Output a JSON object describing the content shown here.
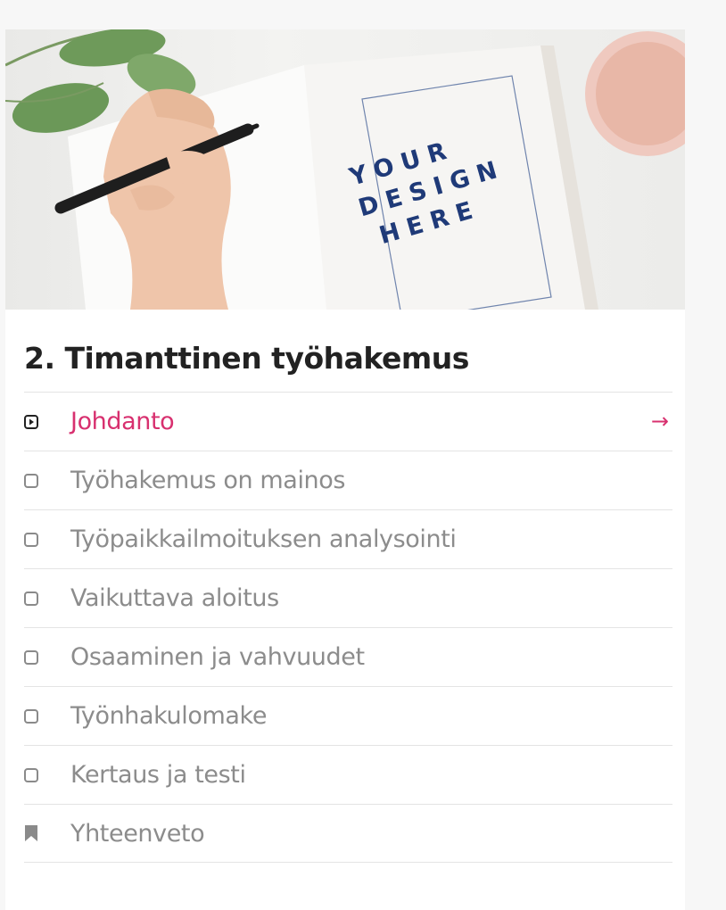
{
  "hero": {
    "image_text": [
      "YOUR",
      "DESIGN",
      "HERE"
    ]
  },
  "course": {
    "title": "2. Timanttinen työhakemus"
  },
  "lessons": [
    {
      "label": "Johdanto",
      "icon": "play-square-icon",
      "active": true
    },
    {
      "label": "Työhakemus on mainos",
      "icon": "square-outline-icon"
    },
    {
      "label": "Työpaikkailmoituksen analysointi",
      "icon": "square-outline-icon"
    },
    {
      "label": "Vaikuttava aloitus",
      "icon": "square-outline-icon"
    },
    {
      "label": "Osaaminen ja vahvuudet",
      "icon": "square-outline-icon"
    },
    {
      "label": "Työnhakulomake",
      "icon": "square-outline-icon"
    },
    {
      "label": "Kertaus ja testi",
      "icon": "square-outline-icon"
    },
    {
      "label": "Yhteenveto",
      "icon": "bookmark-icon"
    }
  ],
  "active_arrow": "→",
  "colors": {
    "accent": "#d8306f",
    "muted_text": "#8c8c8c",
    "title": "#222222",
    "hero_text": "#1f3a78"
  }
}
